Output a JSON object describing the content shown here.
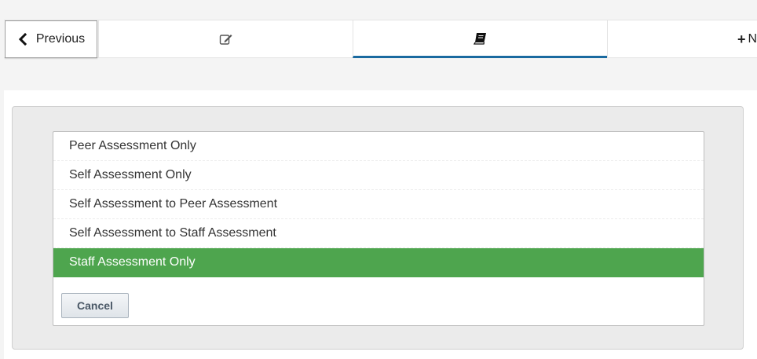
{
  "nav": {
    "previous_label": "Previous",
    "next_label": "Ne",
    "tabs": [
      {
        "icon": "edit-icon"
      },
      {
        "icon": "book-icon",
        "active": true
      }
    ]
  },
  "options": [
    {
      "label": "Peer Assessment Only"
    },
    {
      "label": "Self Assessment Only"
    },
    {
      "label": "Self Assessment to Peer Assessment"
    },
    {
      "label": "Self Assessment to Staff Assessment"
    },
    {
      "label": "Staff Assessment Only",
      "selected": true
    }
  ],
  "cancel_label": "Cancel",
  "colors": {
    "selected_bg": "#4ea54e",
    "active_tab_underline": "#1a6aa0"
  }
}
